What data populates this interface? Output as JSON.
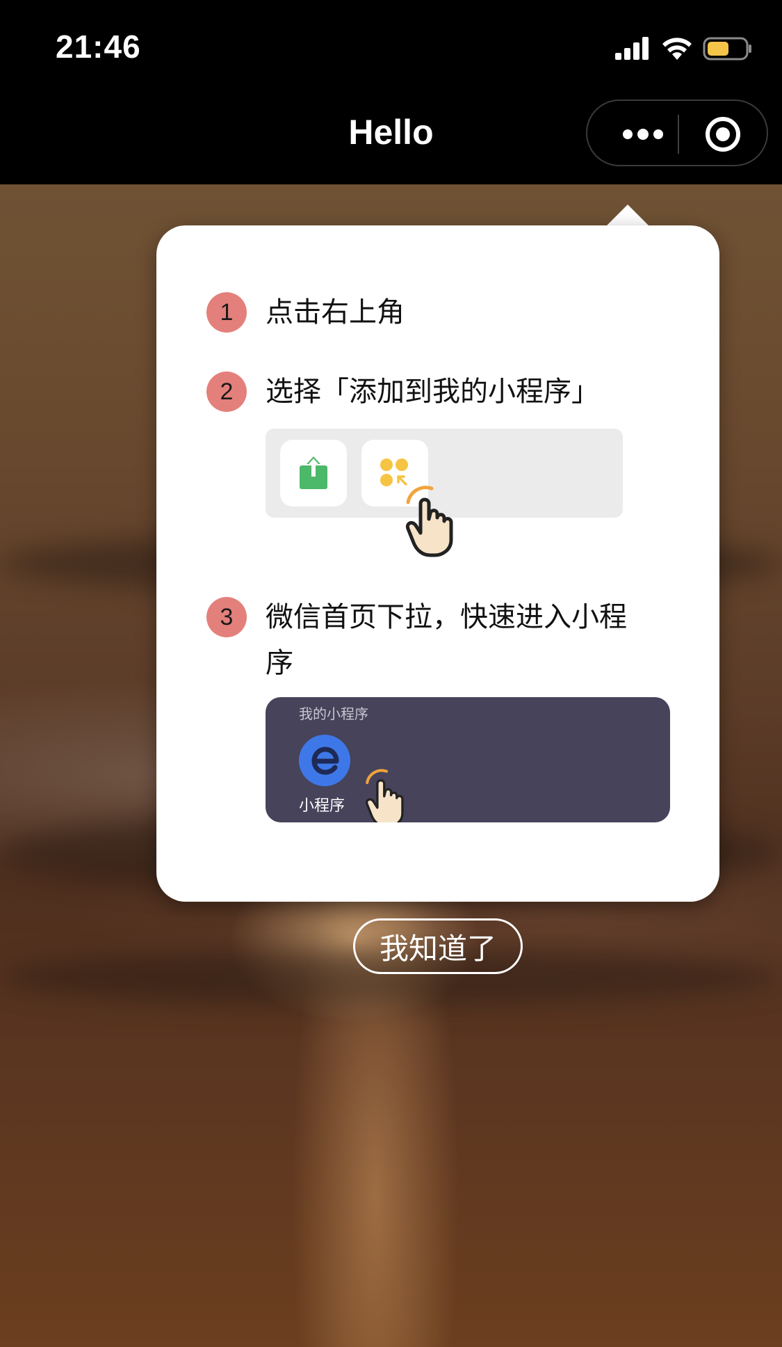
{
  "status_bar": {
    "time": "21:46",
    "icons": [
      "signal-icon",
      "wifi-icon",
      "battery-icon"
    ],
    "battery_color": "#f5c54a"
  },
  "nav_bar": {
    "title": "Hello",
    "capsule": {
      "more_icon": "more-dots-icon",
      "close_icon": "target-close-icon"
    }
  },
  "popup": {
    "steps": [
      {
        "number": "1",
        "text": "点击右上角"
      },
      {
        "number": "2",
        "text": "选择「添加到我的小程序」"
      },
      {
        "number": "3",
        "text_line1": "微信首页下拉，快速进入小程",
        "text_line2": "序"
      }
    ],
    "illustration_1": {
      "icons": [
        "share-upload-icon",
        "add-to-my-miniprogram-icon",
        "pointing-hand-icon"
      ]
    },
    "illustration_2": {
      "section_title": "我的小程序",
      "app_name": "小程序",
      "app_icon": "miniprogram-e-icon"
    },
    "step_color": "#e4807b"
  },
  "confirm_button": {
    "label": "我知道了"
  }
}
